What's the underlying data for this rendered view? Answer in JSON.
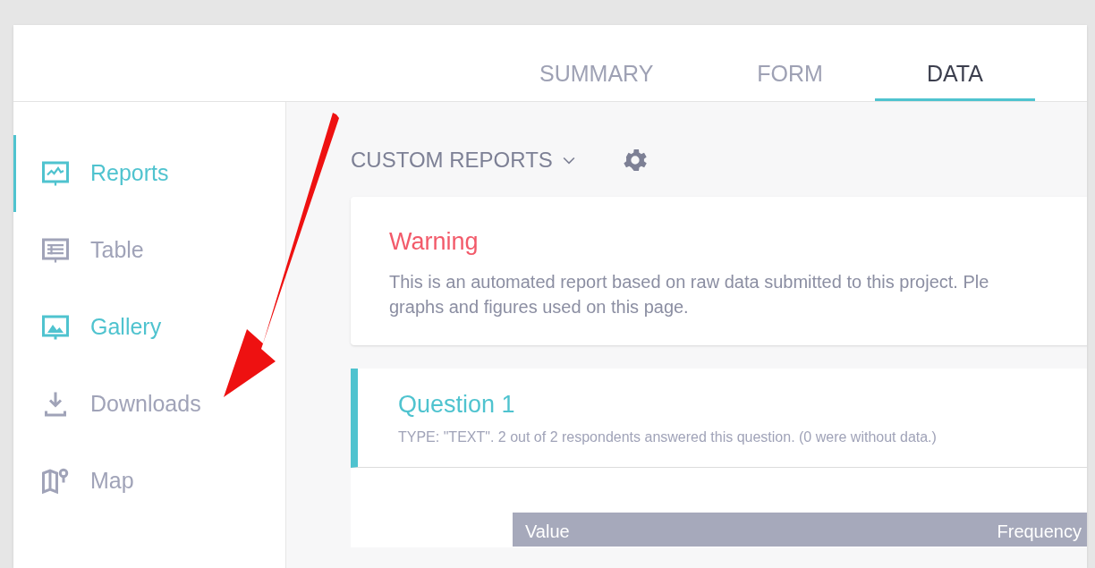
{
  "tabs": [
    {
      "label": "SUMMARY",
      "selected": false
    },
    {
      "label": "FORM",
      "selected": false
    },
    {
      "label": "DATA",
      "selected": true
    }
  ],
  "sidebar": {
    "items": [
      {
        "label": "Reports",
        "kind": "reports",
        "selected": true,
        "highlighted": true
      },
      {
        "label": "Table",
        "kind": "table",
        "selected": false,
        "highlighted": false
      },
      {
        "label": "Gallery",
        "kind": "gallery",
        "selected": false,
        "highlighted": true
      },
      {
        "label": "Downloads",
        "kind": "downloads",
        "selected": false,
        "highlighted": false
      },
      {
        "label": "Map",
        "kind": "map",
        "selected": false,
        "highlighted": false
      }
    ]
  },
  "toolbar": {
    "report_menu": "CUSTOM REPORTS"
  },
  "warning": {
    "title": "Warning",
    "lines": [
      "This is an automated report based on raw data submitted to this project. Ple",
      "graphs and figures used on this page."
    ]
  },
  "question": {
    "title": "Question 1",
    "subtitle": "TYPE: \"TEXT\". 2 out of 2 respondents answered this question. (0 were without data.)"
  },
  "table": {
    "columns": [
      "Value",
      "Frequency"
    ]
  }
}
